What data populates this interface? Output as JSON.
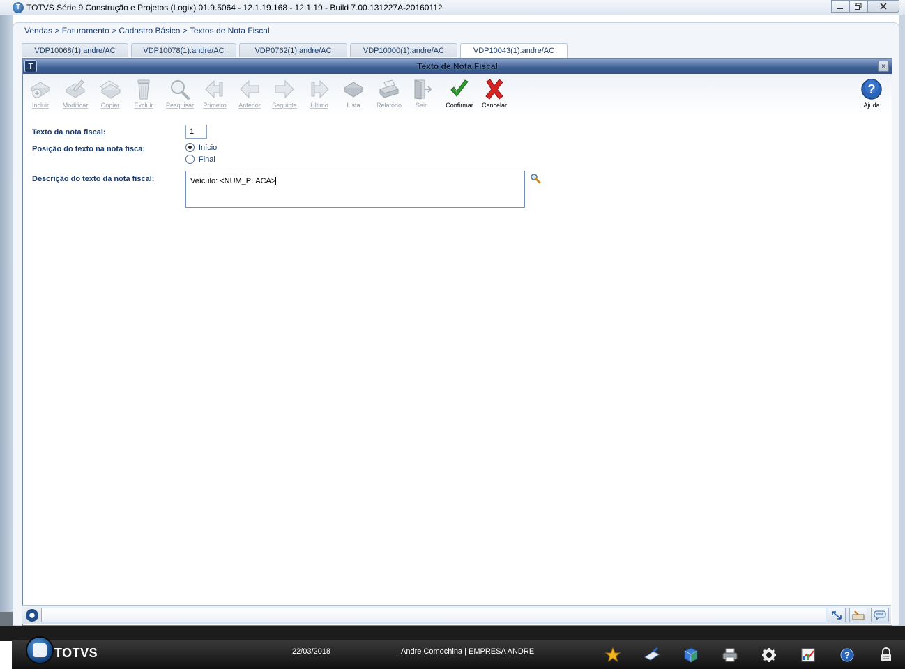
{
  "window": {
    "title": "TOTVS Série 9 Construção e Projetos (Logix) 01.9.5064  -  12.1.19.168 - 12.1.19 - Build 7.00.131227A-20160112",
    "controls": [
      "minimize",
      "maximize",
      "close"
    ]
  },
  "breadcrumb": "Vendas > Faturamento > Cadastro Básico > Textos de Nota Fiscal",
  "tabs": [
    {
      "label": "VDP10068(1):andre/AC",
      "active": false
    },
    {
      "label": "VDP10078(1):andre/AC",
      "active": false
    },
    {
      "label": "VDP0762(1):andre/AC",
      "active": false
    },
    {
      "label": "VDP10000(1):andre/AC",
      "active": false
    },
    {
      "label": "VDP10043(1):andre/AC",
      "active": true
    }
  ],
  "dialog": {
    "title": "Texto de Nota Fiscal",
    "close": "×"
  },
  "toolbar": {
    "buttons": [
      {
        "label": "Incluir",
        "enabled": false,
        "icon": "add-document-icon"
      },
      {
        "label": "Modificar",
        "enabled": false,
        "icon": "edit-document-icon"
      },
      {
        "label": "Copiar",
        "enabled": false,
        "icon": "copy-document-icon"
      },
      {
        "label": "Excluir",
        "enabled": false,
        "icon": "trash-icon"
      },
      {
        "label": "Pesquisar",
        "enabled": false,
        "icon": "search-icon"
      },
      {
        "label": "Primeiro",
        "enabled": false,
        "icon": "first-icon"
      },
      {
        "label": "Anterior",
        "enabled": false,
        "icon": "previous-icon"
      },
      {
        "label": "Seguinte",
        "enabled": false,
        "icon": "next-icon"
      },
      {
        "label": "Último",
        "enabled": false,
        "icon": "last-icon"
      },
      {
        "label": "Lista",
        "enabled": false,
        "icon": "list-icon"
      },
      {
        "label": "Relatório",
        "enabled": false,
        "icon": "printer-icon"
      },
      {
        "label": "Sair",
        "enabled": false,
        "icon": "exit-door-icon"
      },
      {
        "label": "Confirmar",
        "enabled": true,
        "icon": "checkmark-icon"
      },
      {
        "label": "Cancelar",
        "enabled": true,
        "icon": "cancel-x-icon"
      }
    ],
    "help_label": "Ajuda"
  },
  "form": {
    "texto_label": "Texto da nota fiscal:",
    "texto_value": "1",
    "posicao_label": "Posição do texto na nota fisca:",
    "posicao_options": [
      {
        "label": "Início",
        "selected": true
      },
      {
        "label": "Final",
        "selected": false
      }
    ],
    "descricao_label": "Descrição do texto da nota fiscal:",
    "descricao_value": "Veículo: <NUM_PLACA>"
  },
  "taskbar": {
    "brand": "TOTVS",
    "date": "22/03/2018",
    "user": "Andre Comochina | EMPRESA ANDRE",
    "icons": [
      "star-icon",
      "brush-icon",
      "cube-icon",
      "printer-icon",
      "gear-icon",
      "chart-icon",
      "help-icon",
      "lock-icon"
    ]
  },
  "colors": {
    "dialog_title": "#3e5f94",
    "label_blue": "#1a3c6e",
    "confirm_green": "#2e9a2e",
    "cancel_red": "#d62424"
  }
}
